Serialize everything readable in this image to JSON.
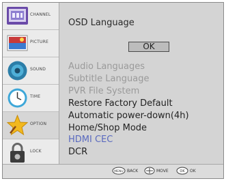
{
  "sidebar": {
    "items": [
      {
        "label": "CHANNEL",
        "icon": "tv-icon"
      },
      {
        "label": "PICTURE",
        "icon": "picture-icon"
      },
      {
        "label": "SOUND",
        "icon": "speaker-icon"
      },
      {
        "label": "TIME",
        "icon": "clock-icon"
      },
      {
        "label": "OPTION",
        "icon": "star-icon"
      },
      {
        "label": "LOCK",
        "icon": "padlock-icon"
      }
    ],
    "active_index": 4
  },
  "menu": {
    "title": "OSD Language",
    "ok_label": "OK",
    "options": [
      {
        "label": "Audio Languages",
        "state": "disabled"
      },
      {
        "label": "Subtitle Language",
        "state": "disabled"
      },
      {
        "label": "PVR File System",
        "state": "disabled"
      },
      {
        "label": "Restore Factory Default",
        "state": "normal"
      },
      {
        "label": "Automatic power-down(4h)",
        "state": "normal"
      },
      {
        "label": "Home/Shop Mode",
        "state": "normal"
      },
      {
        "label": "HDMI CEC",
        "state": "highlight"
      },
      {
        "label": "DCR",
        "state": "normal"
      }
    ]
  },
  "footer": {
    "back": {
      "key": "MENU",
      "label": "BACK"
    },
    "move": {
      "label": "MOVE"
    },
    "ok": {
      "key": "OK",
      "label": "OK"
    }
  },
  "colors": {
    "highlight": "#5a6abf",
    "disabled": "#9a9a9a"
  }
}
